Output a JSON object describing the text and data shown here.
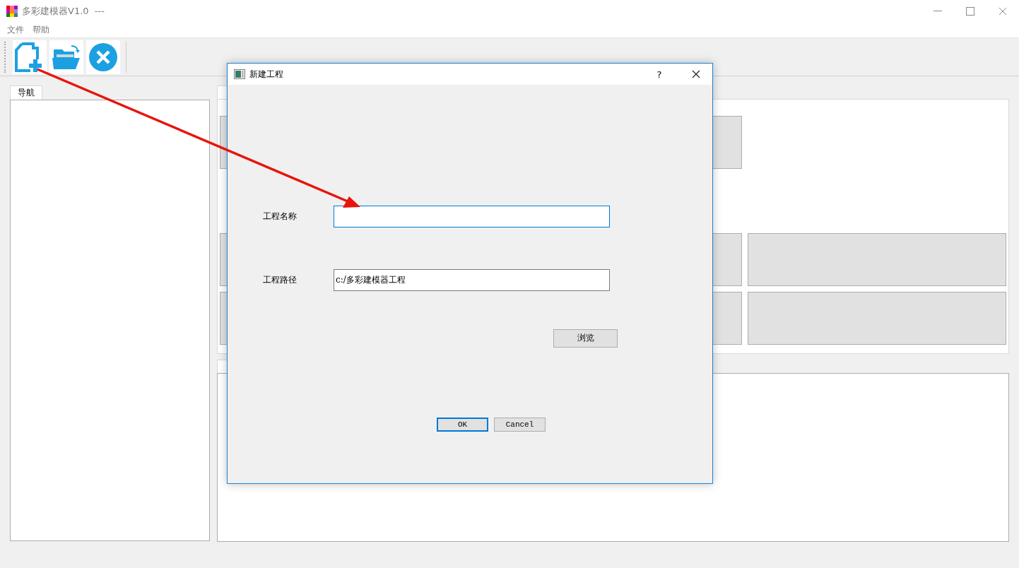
{
  "window": {
    "title": "多彩建模器V1.0  ---"
  },
  "menu": [
    {
      "label": "文件"
    },
    {
      "label": "帮助"
    }
  ],
  "toolbar": [
    {
      "kind": "new"
    },
    {
      "kind": "open"
    },
    {
      "kind": "close"
    }
  ],
  "navigation": {
    "tab": "导航"
  },
  "dialog": {
    "title": "新建工程",
    "help": "?",
    "fields": [
      {
        "label": "工程名称",
        "focused": true
      },
      {
        "label": "工程路径",
        "value": "c:/多彩建模器工程",
        "focused": false
      }
    ],
    "browse": "浏览",
    "buttons": [
      {
        "label": "OK",
        "default": true
      },
      {
        "label": "Cancel",
        "default": false
      }
    ]
  }
}
